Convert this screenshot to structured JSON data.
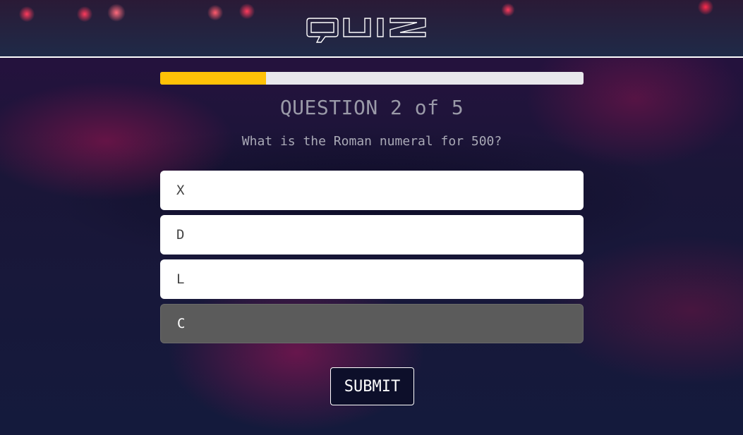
{
  "header": {
    "logo_text": "QUIZ"
  },
  "progress": {
    "value": 0.25,
    "fill_color": "#ffc107",
    "track_color": "#e8e8ec"
  },
  "question": {
    "counter": "QUESTION 2 of 5",
    "text": "What is the Roman numeral for 500?"
  },
  "options": [
    {
      "label": "X",
      "selected": false
    },
    {
      "label": "D",
      "selected": false
    },
    {
      "label": "L",
      "selected": false
    },
    {
      "label": "C",
      "selected": true
    }
  ],
  "submit_label": "SUBMIT",
  "colors": {
    "accent": "#ffc107",
    "selected_option": "#5b5b5b",
    "background": "#13183a"
  }
}
